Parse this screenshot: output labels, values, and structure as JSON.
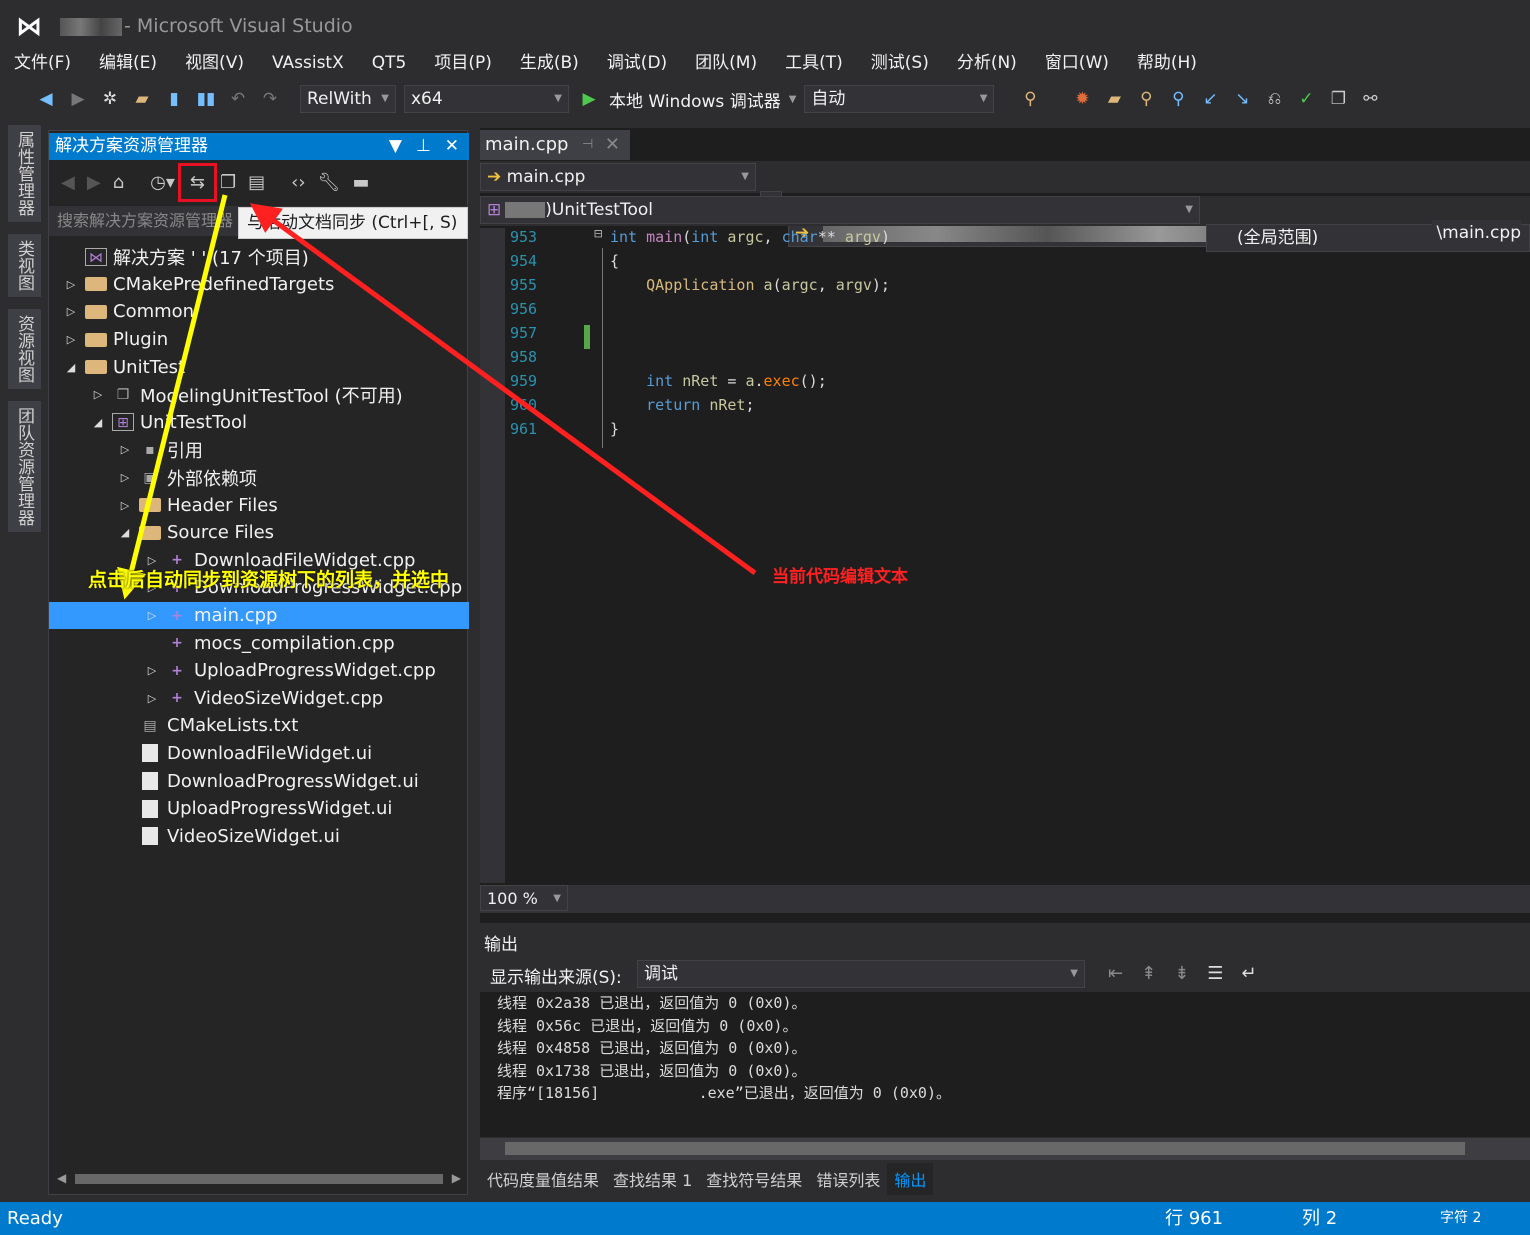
{
  "window": {
    "title": "- Microsoft Visual Studio"
  },
  "menu": [
    "文件(F)",
    "编辑(E)",
    "视图(V)",
    "VAssistX",
    "QT5",
    "项目(P)",
    "生成(B)",
    "调试(D)",
    "团队(M)",
    "工具(T)",
    "测试(S)",
    "分析(N)",
    "窗口(W)",
    "帮助(H)"
  ],
  "toolbar": {
    "config": "RelWith",
    "platform": "x64",
    "debugger": "本地 Windows 调试器",
    "mode": "自动"
  },
  "left_tabs": [
    "属性管理器",
    "类视图",
    "资源视图",
    "团队资源管理器"
  ],
  "solution_explorer": {
    "title": "解决方案资源管理器",
    "search_placeholder": "搜索解决方案资源管理器",
    "tooltip": "与活动文档同步 (Ctrl+[, S)",
    "items": [
      {
        "label": "解决方案 '      ' (17 个项目)",
        "icon": "solution",
        "level": 0,
        "expander": ""
      },
      {
        "label": "CMakePredefinedTargets",
        "icon": "folder",
        "level": 0,
        "expander": "collapsed"
      },
      {
        "label": "Common",
        "icon": "folder",
        "level": 0,
        "expander": "collapsed"
      },
      {
        "label": "Plugin",
        "icon": "folder",
        "level": 0,
        "expander": "collapsed"
      },
      {
        "label": "UnitTest",
        "icon": "folder-open",
        "level": 0,
        "expander": "expanded"
      },
      {
        "label": "ModelingUnitTestTool (不可用)",
        "icon": "project-unavailable",
        "level": 1,
        "expander": "collapsed"
      },
      {
        "label": "UnitTestTool",
        "icon": "project",
        "level": 1,
        "expander": "expanded"
      },
      {
        "label": "引用",
        "icon": "references",
        "level": 2,
        "expander": "collapsed"
      },
      {
        "label": "外部依赖项",
        "icon": "external",
        "level": 2,
        "expander": "collapsed"
      },
      {
        "label": "Header Files",
        "icon": "folder",
        "level": 2,
        "expander": "collapsed"
      },
      {
        "label": "Source Files",
        "icon": "folder-open",
        "level": 2,
        "expander": "expanded"
      },
      {
        "label": "DownloadFileWidget.cpp",
        "icon": "cpp",
        "level": 3,
        "expander": "collapsed"
      },
      {
        "label": "DownloadProgressWidget.cpp",
        "icon": "cpp",
        "level": 3,
        "expander": "collapsed"
      },
      {
        "label": "main.cpp",
        "icon": "cpp",
        "level": 3,
        "expander": "collapsed",
        "selected": true
      },
      {
        "label": "mocs_compilation.cpp",
        "icon": "cpp",
        "level": 3,
        "expander": ""
      },
      {
        "label": "UploadProgressWidget.cpp",
        "icon": "cpp",
        "level": 3,
        "expander": "collapsed"
      },
      {
        "label": "VideoSizeWidget.cpp",
        "icon": "cpp",
        "level": 3,
        "expander": "collapsed"
      },
      {
        "label": "CMakeLists.txt",
        "icon": "text-file",
        "level": 2,
        "expander": ""
      },
      {
        "label": "DownloadFileWidget.ui",
        "icon": "ui-file",
        "level": 2,
        "expander": ""
      },
      {
        "label": "DownloadProgressWidget.ui",
        "icon": "ui-file",
        "level": 2,
        "expander": ""
      },
      {
        "label": "UploadProgressWidget.ui",
        "icon": "ui-file",
        "level": 2,
        "expander": ""
      },
      {
        "label": "VideoSizeWidget.ui",
        "icon": "ui-file",
        "level": 2,
        "expander": ""
      }
    ]
  },
  "editor": {
    "tab": "main.cpp",
    "file_combo": "main.cpp",
    "path_suffix": "\\main.cpp",
    "project_combo": ")UnitTestTool",
    "scope_combo": "(全局范围)",
    "zoom": "100 %",
    "lines": [
      {
        "n": "953",
        "html": "<span class='kw'>int</span> <span class='fn'>main</span>(<span class='kw'>int</span> <span class='pa'>argc</span>, <span class='kw'>char</span>** <span class='pa'>argv</span>)"
      },
      {
        "n": "954",
        "html": "{"
      },
      {
        "n": "955",
        "html": "    <span class='ty'>QApplication</span> <span class='pa'>a</span>(<span class='pa'>argc</span>, <span class='pa'>argv</span>);"
      },
      {
        "n": "956",
        "html": ""
      },
      {
        "n": "957",
        "html": ""
      },
      {
        "n": "958",
        "html": ""
      },
      {
        "n": "959",
        "html": "    <span class='kw'>int</span> <span class='pa'>nRet</span> = <span class='pa'>a</span>.<span class='me'>exec</span>();"
      },
      {
        "n": "960",
        "html": "    <span class='kw'>return</span> <span class='pa'>nRet</span>;"
      },
      {
        "n": "961",
        "html": "}"
      }
    ]
  },
  "output": {
    "title": "输出",
    "source_label": "显示输出来源(S):",
    "source_value": "调试",
    "lines": [
      "线程 0x2a38 已退出，返回值为 0 (0x0)。",
      "线程 0x56c 已退出，返回值为 0 (0x0)。",
      "线程 0x4858 已退出，返回值为 0 (0x0)。",
      "线程 0x1738 已退出，返回值为 0 (0x0)。",
      "程序“[18156]           .exe”已退出，返回值为 0 (0x0)。"
    ],
    "tabs": [
      "代码度量值结果",
      "查找结果 1",
      "查找符号结果",
      "错误列表",
      "输出"
    ],
    "active_tab": "输出"
  },
  "status": {
    "text": "Ready",
    "line": "行 961",
    "col": "列 2",
    "char": "字符 2"
  },
  "annotations": {
    "yellow": "点击后自动同步到资源树下的列表，并选中",
    "red": "当前代码编辑文本",
    "yellow_color": "#ffff00",
    "red_color": "#ff2020"
  }
}
